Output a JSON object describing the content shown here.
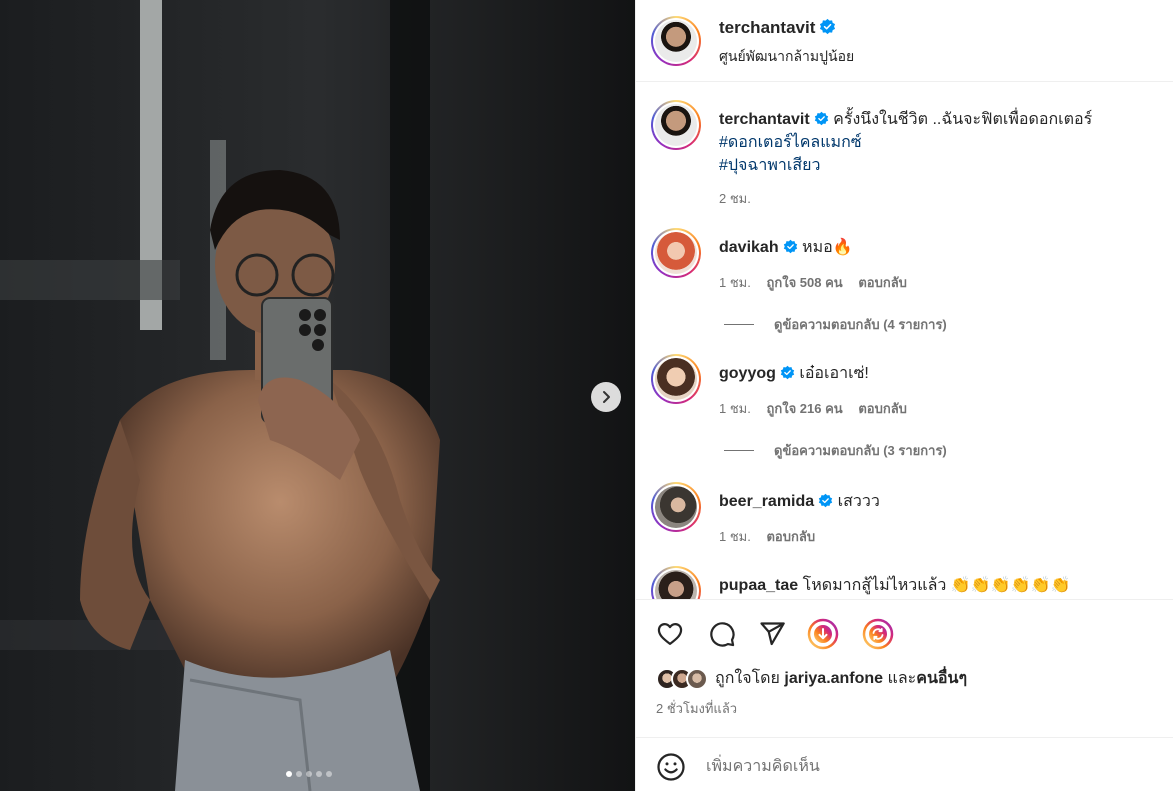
{
  "post": {
    "author": "terchantavit",
    "location": "ศูนย์พัฒนากล้ามปูน้อย",
    "image_alt": "ชายถ่ายเซลฟี่หน้ากระจก",
    "carousel_total": 5,
    "carousel_index": 1
  },
  "caption": {
    "username": "terchantavit",
    "text": "ครั้งนึงในชีวิต ..ฉันจะฟิตเพื่อดอกเตอร์",
    "tags": [
      "#ดอกเตอร์ไคลแมกซ์",
      "#ปุจฉาพาเสียว"
    ],
    "time": "2 ชม."
  },
  "comments": [
    {
      "username": "davikah",
      "text": "หมอ🔥",
      "time": "1 ชม.",
      "likes": "ถูกใจ 508 คน",
      "reply": "ตอบกลับ",
      "view_replies": "ดูข้อความตอบกลับ (4 รายการ)"
    },
    {
      "username": "goyyog",
      "text": "เอ๋อเอาเซ่!",
      "time": "1 ชม.",
      "likes": "ถูกใจ 216 คน",
      "reply": "ตอบกลับ",
      "view_replies": "ดูข้อความตอบกลับ (3 รายการ)"
    },
    {
      "username": "beer_ramida",
      "text": "เสววว",
      "time": "1 ชม.",
      "reply": "ตอบกลับ"
    },
    {
      "username": "pupaa_tae",
      "text": "โหดมากสู้ไม่ไหวแล้ว 👏👏👏👏👏👏"
    }
  ],
  "actions": {
    "like": "heart-icon",
    "comment": "comment-icon",
    "share": "send-icon",
    "download": "download-icon",
    "repost": "repost-icon"
  },
  "liked_by": {
    "prefix": "ถูกใจโดย",
    "user": "jariya.anfone",
    "connector": "และ",
    "others": "คนอื่นๆ"
  },
  "timestamp": "2 ชั่วโมงที่แล้ว",
  "add_comment": {
    "placeholder": "เพิ่มความคิดเห็น"
  },
  "colors": {
    "verified": "#0095f6",
    "tag": "#00376b",
    "secondary_text": "#737373"
  }
}
